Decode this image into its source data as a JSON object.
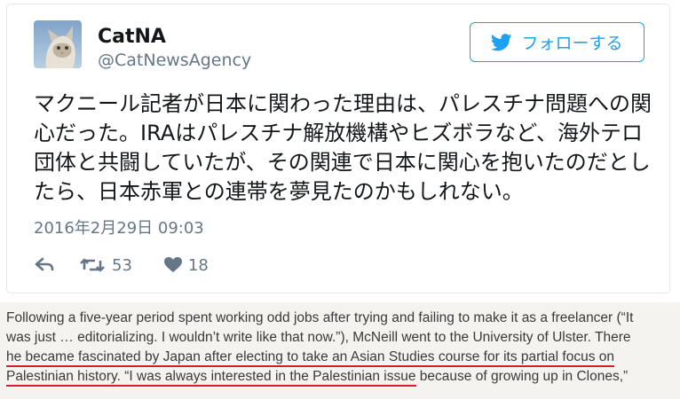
{
  "tweet": {
    "display_name": "CatNA",
    "handle": "@CatNewsAgency",
    "follow_label": "フォローする",
    "text": "マクニール記者が日本に関わった理由は、パレスチナ問題への関心だった。IRAはパレスチナ解放機構やヒズボラなど、海外テロ団体と共闘していたが、その関連で日本に関心を抱いたのだとしたら、日本赤軍との連帯を夢見たのかもしれない。",
    "timestamp": "2016年2月29日 09:03",
    "retweet_count": "53",
    "like_count": "18",
    "icons": {
      "follow": "twitter-bird-icon",
      "reply": "reply-icon",
      "retweet": "retweet-icon",
      "like": "heart-icon"
    },
    "colors": {
      "accent": "#1da1f2",
      "muted": "#657786",
      "underline": "#d11f2b"
    }
  },
  "article": {
    "line1": "Following a five-year period spent working odd jobs after trying and failing to make it as a freelancer (“It",
    "line2": "was just … editorializing. I wouldn’t write like that now.”), McNeill went to the University of Ulster. There",
    "line3_underlined": "he became fascinated by Japan after electing to take an Asian Studies course for its partial focus on",
    "line4_underlined": "Palestinian history. “I was always interested in the Palestinian issue",
    "line4_rest": " because of growing up in Clones,”"
  }
}
